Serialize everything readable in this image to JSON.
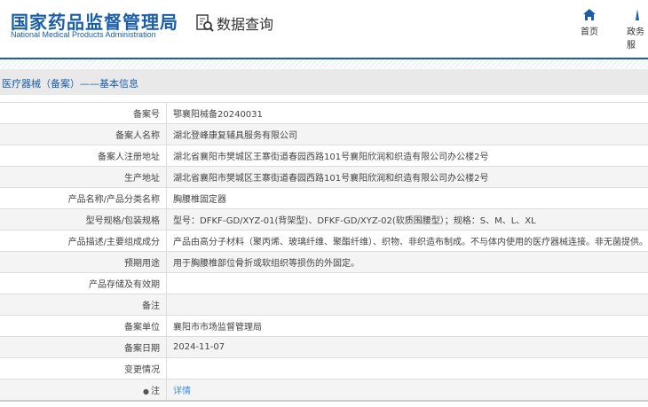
{
  "header": {
    "logo_cn": "国家药品监督管理局",
    "logo_en": "National Medical Products Administration",
    "data_query": "数据查询",
    "nav": [
      {
        "label": "首页"
      },
      {
        "label": "政务服"
      }
    ]
  },
  "section_title": "医疗器械（备案）——基本信息",
  "rows": [
    {
      "label": "备案号",
      "value": "鄂襄阳械备20240031"
    },
    {
      "label": "备案人名称",
      "value": "湖北登峰康复辅具服务有限公司"
    },
    {
      "label": "备案人注册地址",
      "value": "湖北省襄阳市樊城区王寨街道春园西路101号襄阳欣润和织造有限公司办公楼2号"
    },
    {
      "label": "生产地址",
      "value": "湖北省襄阳市樊城区王寨街道春园西路101号襄阳欣润和织造有限公司办公楼2号"
    },
    {
      "label": "产品名称/产品分类名称",
      "value": "胸腰椎固定器"
    },
    {
      "label": "型号规格/包装规格",
      "value": "型号：DFKF-GD/XYZ-01(背架型)、DFKF-GD/XYZ-02(软质围腰型）；规格：S、M、L、XL"
    },
    {
      "label": "产品描述/主要组成成分",
      "value": "产品由高分子材料（聚丙烯、玻璃纤维、聚酯纤维）、织物、非织造布制成。不与体内使用的医疗器械连接。非无菌提供。"
    },
    {
      "label": "预期用途",
      "value": "用于胸腰椎部位骨折或软组织等损伤的外固定。"
    },
    {
      "label": "产品存储及有效期",
      "value": ""
    },
    {
      "label": "备注",
      "value": ""
    },
    {
      "label": "备案单位",
      "value": "襄阳市市场监督管理局"
    },
    {
      "label": "备案日期",
      "value": "2024-11-07"
    },
    {
      "label": "变更情况",
      "value": ""
    },
    {
      "label": "注",
      "value": "详情"
    }
  ]
}
